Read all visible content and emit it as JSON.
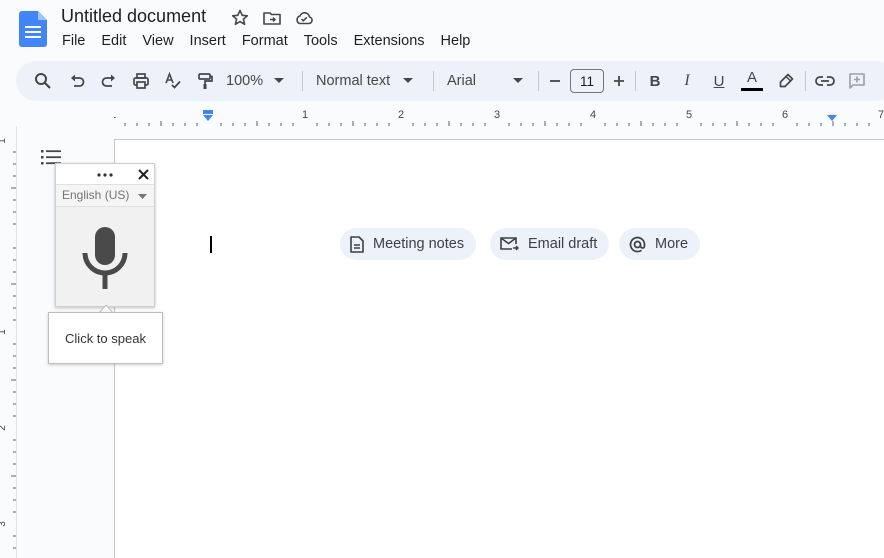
{
  "app": {
    "doc_title": "Untitled document"
  },
  "menu": [
    "File",
    "Edit",
    "View",
    "Insert",
    "Format",
    "Tools",
    "Extensions",
    "Help"
  ],
  "toolbar": {
    "zoom": "100%",
    "style": "Normal text",
    "font": "Arial",
    "font_size": "11",
    "icons": [
      "search-icon",
      "undo-icon",
      "redo-icon",
      "print-icon",
      "spellcheck-icon",
      "paint-format-icon",
      "decrease-font-icon",
      "increase-font-icon",
      "bold-icon",
      "italic-icon",
      "underline-icon",
      "text-color-icon",
      "highlight-icon",
      "link-icon",
      "add-comment-icon"
    ],
    "bold_label": "B",
    "italic_label": "I",
    "underline_label": "U",
    "text_color_label": "A"
  },
  "ruler": {
    "h_labels": [
      "1",
      "1",
      "2",
      "3",
      "4",
      "5",
      "6",
      "7"
    ],
    "v_labels": [
      "1",
      "1",
      "2",
      "3"
    ]
  },
  "chips": [
    {
      "label": "Meeting notes",
      "icon": "document-icon"
    },
    {
      "label": "Email draft",
      "icon": "email-icon"
    },
    {
      "label": "More",
      "icon": "at-sign-icon"
    }
  ],
  "voice": {
    "language": "English (US)",
    "tooltip": "Click to speak"
  },
  "colors": {
    "brand_blue": "#4285f4",
    "toolbar_bg": "#edf2fa",
    "ruler_marker": "#4285f4"
  }
}
